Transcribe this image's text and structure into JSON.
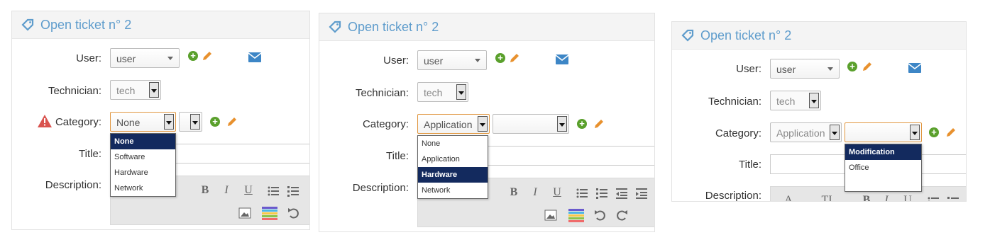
{
  "panels": [
    {
      "title": "Open ticket n° 2",
      "labels": {
        "user": "User:",
        "technician": "Technician:",
        "category": "Category:",
        "title": "Title:",
        "description": "Description:"
      },
      "user_value": "user",
      "technician_value": "tech",
      "category_value": "None",
      "subcategory_value": "",
      "dropdown_options": [
        "None",
        "Software",
        "Hardware",
        "Network"
      ],
      "dropdown_selected": "None"
    },
    {
      "title": "Open ticket n° 2",
      "labels": {
        "user": "User:",
        "technician": "Technician:",
        "category": "Category:",
        "title": "Title:",
        "description": "Description:"
      },
      "user_value": "user",
      "technician_value": "tech",
      "category_value": "Application",
      "subcategory_value": "",
      "dropdown_options": [
        "None",
        "Application",
        "Hardware",
        "Network"
      ],
      "dropdown_selected": "Hardware"
    },
    {
      "title": "Open ticket n° 2",
      "labels": {
        "user": "User:",
        "technician": "Technician:",
        "category": "Category:",
        "title": "Title:",
        "description": "Description:"
      },
      "user_value": "user",
      "technician_value": "tech",
      "category_value": "Application",
      "subcategory_value": "",
      "dropdown_options": [
        "Modification",
        "Office"
      ],
      "dropdown_selected": "Modification"
    }
  ],
  "toolbar": {
    "bold": "B",
    "italic": "I",
    "underline": "U",
    "font": "A",
    "text": "TI"
  },
  "colors": {
    "title_blue": "#5e9ccc",
    "add_green": "#5aa02c",
    "edit_orange": "#e8912e",
    "mail_blue": "#3d86c6",
    "warn_red": "#d9534f",
    "selected_navy": "#132a5e"
  }
}
